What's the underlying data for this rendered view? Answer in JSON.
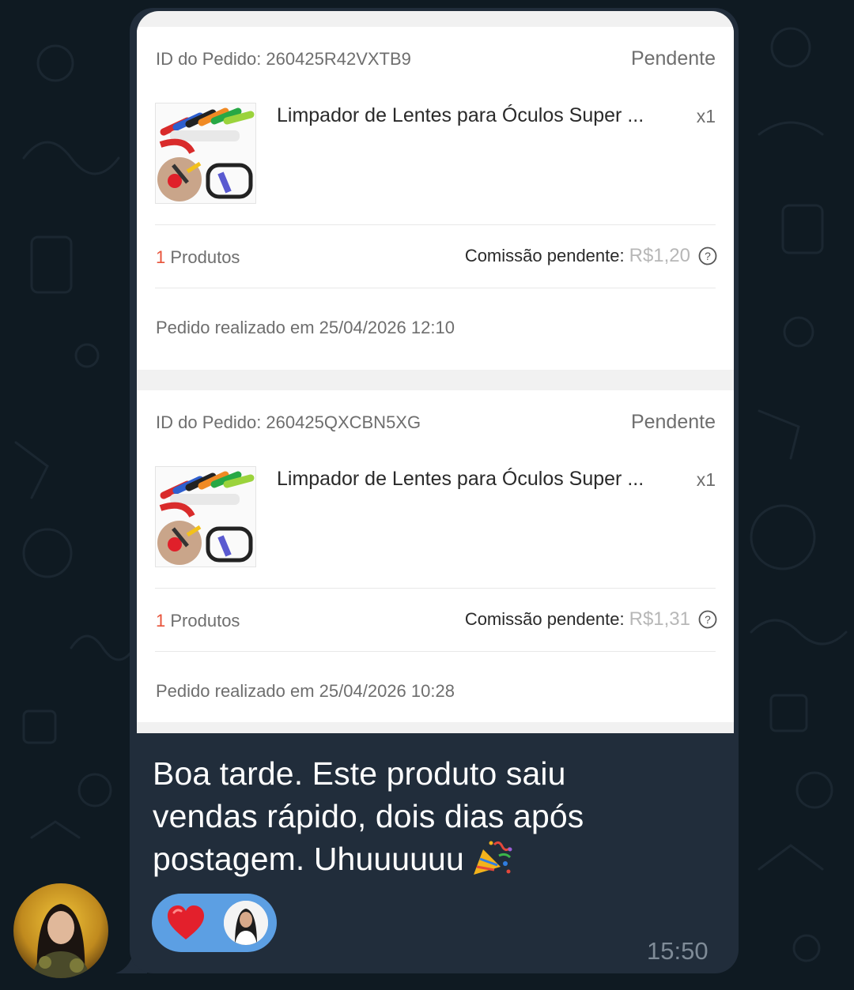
{
  "orders": [
    {
      "id_text": "ID do Pedido: 260425R42VXTB9",
      "status": "Pendente",
      "product_name": "Limpador de Lentes para Óculos Super ...",
      "quantity": "x1",
      "products_count": "1",
      "products_label": "Produtos",
      "commission_label": "Comissão pendente:",
      "commission_value": "R$1,20",
      "date_text": "Pedido realizado em 25/04/2026 12:10"
    },
    {
      "id_text": "ID do Pedido: 260425QXCBN5XG",
      "status": "Pendente",
      "product_name": "Limpador de Lentes para Óculos Super ...",
      "quantity": "x1",
      "products_count": "1",
      "products_label": "Produtos",
      "commission_label": "Comissão pendente:",
      "commission_value": "R$1,31",
      "date_text": "Pedido realizado em 25/04/2026 10:28"
    }
  ],
  "message": {
    "lines": [
      "Boa tarde. Este produto saiu",
      "vendas rápido, dois dias após",
      "postagem. Uhuuuuuu"
    ],
    "emoji_icon": "party-popper-icon",
    "time": "15:50"
  },
  "reaction": {
    "emoji_icon": "red-heart-icon"
  },
  "colors": {
    "chat_background": "#0f1a22",
    "bubble": "#212d3b",
    "reaction_pill": "#5c9fe3",
    "accent_count": "#e8533a",
    "commission_value": "#b7b7b7"
  }
}
